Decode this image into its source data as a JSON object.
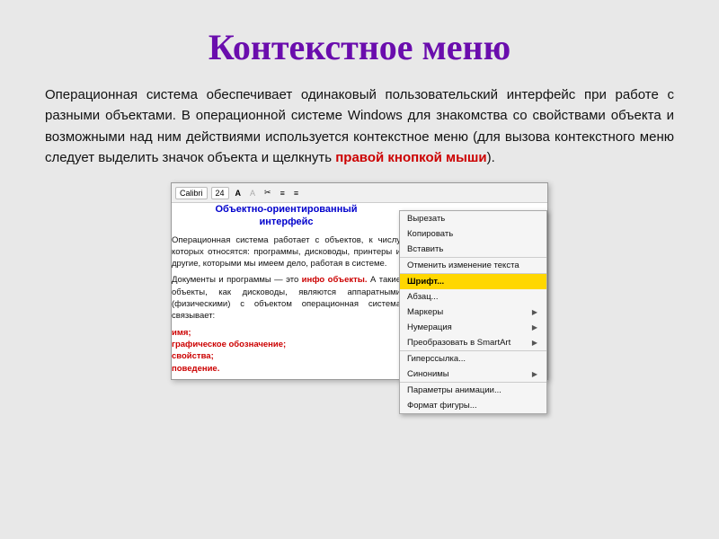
{
  "slide": {
    "title": "Контекстное меню",
    "body_text": "Операционная система обеспечивает одинаковый пользовательский интерфейс при работе с разными объектами. В операционной системе Windows для знакомства со свойствами объекта и возможными над ним действиями используется контекстное меню (для вызова контекстного меню следует выделить значок объекта и щелкнуть ",
    "highlight": "правой кнопкой мыши",
    "body_end": ").",
    "doc_title_line1": "Объектно-ориентированный",
    "doc_title_line2": "интерфейс",
    "doc_para1": "Операционная система работает с объектов, к числу которых относятся: программы, дисководы, принтеры и другие, которыми мы имеем дело, работая в системе.",
    "doc_para2": "Документы и программы — это ",
    "doc_para2_red": "инфо объекты.",
    "doc_para2_cont": " А такие объекты, как дисководы, являются аппаратными (физическими) с объектом операционная система связывает:",
    "doc_list": [
      "имя;",
      "графическое обозначение;",
      "свойства;",
      "поведение."
    ],
    "toolbar_items": [
      "Calibri",
      "24",
      "A",
      "A"
    ],
    "context_menu": [
      {
        "label": "Вырезать",
        "arrow": false,
        "highlighted": false
      },
      {
        "label": "Копировать",
        "arrow": false,
        "highlighted": false
      },
      {
        "label": "Вставить",
        "arrow": false,
        "highlighted": false
      },
      {
        "label": "Отменить изменение текста",
        "arrow": false,
        "highlighted": false,
        "separator": true
      },
      {
        "label": "Шрифт...",
        "arrow": false,
        "highlighted": true
      },
      {
        "label": "Абзац...",
        "arrow": false,
        "highlighted": false
      },
      {
        "label": "Маркеры",
        "arrow": true,
        "highlighted": false
      },
      {
        "label": "Нумерация",
        "arrow": true,
        "highlighted": false
      },
      {
        "label": "Преобразовать в SmartArt",
        "arrow": true,
        "highlighted": false,
        "separator": true
      },
      {
        "label": "Гиперссылка...",
        "arrow": false,
        "highlighted": false
      },
      {
        "label": "Синонимы",
        "arrow": true,
        "highlighted": false
      },
      {
        "label": "Параметры анимации...",
        "arrow": false,
        "highlighted": false,
        "separator": true
      },
      {
        "label": "Формат фигуры...",
        "arrow": false,
        "highlighted": false
      }
    ]
  }
}
